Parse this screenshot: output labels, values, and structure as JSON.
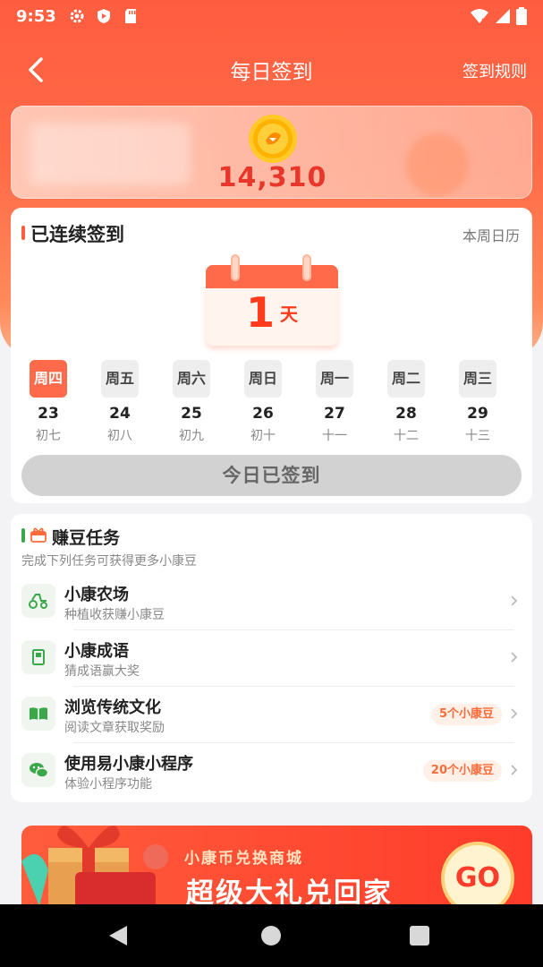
{
  "status_bar": {
    "time": "9:53",
    "icons": [
      "settings-icon",
      "shield-play-icon",
      "sd-card-icon",
      "wifi-icon",
      "signal-icon",
      "battery-icon"
    ]
  },
  "header": {
    "title": "每日签到",
    "rules_link": "签到规则"
  },
  "coins": {
    "value": "14,310"
  },
  "signin": {
    "title": "已连续签到",
    "calendar_link": "本周日历",
    "streak_days": "1",
    "streak_unit": "天",
    "week": [
      {
        "label": "周四",
        "day": "23",
        "lunar": "初七",
        "active": true
      },
      {
        "label": "周五",
        "day": "24",
        "lunar": "初八",
        "active": false
      },
      {
        "label": "周六",
        "day": "25",
        "lunar": "初九",
        "active": false
      },
      {
        "label": "周日",
        "day": "26",
        "lunar": "初十",
        "active": false
      },
      {
        "label": "周一",
        "day": "27",
        "lunar": "十一",
        "active": false
      },
      {
        "label": "周二",
        "day": "28",
        "lunar": "十二",
        "active": false
      },
      {
        "label": "周三",
        "day": "29",
        "lunar": "十三",
        "active": false
      }
    ],
    "button_label": "今日已签到"
  },
  "tasks": {
    "title": "赚豆任务",
    "subtitle": "完成下列任务可获得更多小康豆",
    "items": [
      {
        "name": "小康农场",
        "desc": "种植收获赚小康豆",
        "reward": "",
        "icon": "tractor-icon"
      },
      {
        "name": "小康成语",
        "desc": "猜成语赢大奖",
        "reward": "",
        "icon": "book-icon"
      },
      {
        "name": "浏览传统文化",
        "desc": "阅读文章获取奖励",
        "reward": "5个小康豆",
        "icon": "open-book-icon"
      },
      {
        "name": "使用易小康小程序",
        "desc": "体验小程序功能",
        "reward": "20个小康豆",
        "icon": "wechat-icon"
      }
    ]
  },
  "banner": {
    "subtitle": "小康币兑换商城",
    "title": "超级大礼兑回家",
    "go_label": "GO"
  },
  "colors": {
    "brand": "#ff5d3f",
    "coin_text": "#e8372a",
    "reward_text": "#ff6b3a",
    "task_accent": "#3aa84a"
  }
}
